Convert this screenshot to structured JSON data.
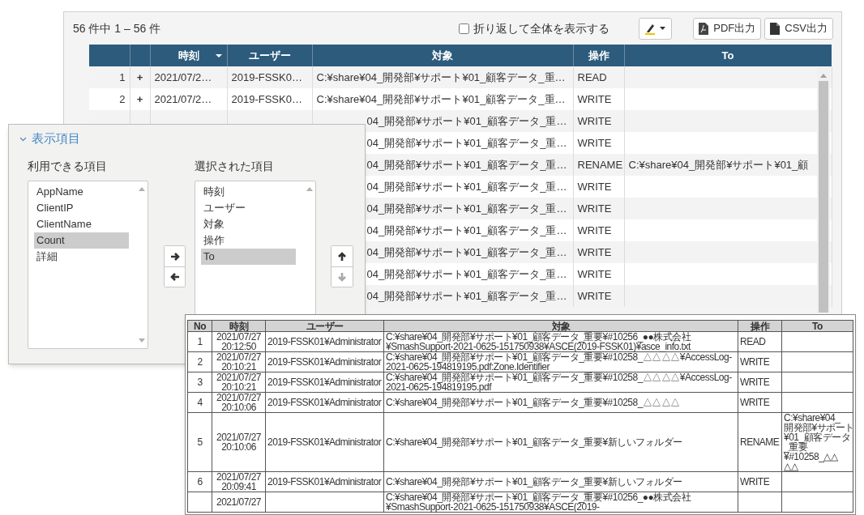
{
  "toolbar": {
    "count": "56 件中 1 – 56 件",
    "wrap": {
      "label": "折り返して全体を表示する",
      "checked": false
    },
    "buttons": [
      {
        "kind": "highlight"
      },
      {
        "kind": "pdf",
        "label": "PDF出力"
      },
      {
        "kind": "csv",
        "label": "CSV出力"
      }
    ]
  },
  "table": {
    "columns": [
      {
        "label": "時刻",
        "sorted": true
      },
      {
        "label": "ユーザー",
        "sorted": false
      },
      {
        "label": "対象",
        "sorted": false
      },
      {
        "label": "操作",
        "sorted": false
      },
      {
        "label": "To",
        "sorted": false
      }
    ],
    "rows": [
      {
        "no": "1",
        "expand": "+",
        "time": "2021/07/2…",
        "user": "2019-FSSK0…",
        "target": "C:¥share¥04_開発部¥サポート¥01_顧客データ_重…",
        "op": "READ"
      },
      {
        "no": "2",
        "expand": "+",
        "time": "2021/07/2…",
        "user": "2019-FSSK0…",
        "target": "C:¥share¥04_開発部¥サポート¥01_顧客データ_重…",
        "op": "WRITE"
      },
      {
        "target": "04_開発部¥サポート¥01_顧客データ_重…",
        "op": "WRITE"
      },
      {
        "target": "04_開発部¥サポート¥01_顧客データ_重…",
        "op": "WRITE"
      },
      {
        "target": "04_開発部¥サポート¥01_顧客データ_重…",
        "op": "RENAME",
        "to": "C:¥share¥04_開発部¥サポート¥01_顧"
      },
      {
        "target": "04_開発部¥サポート¥01_顧客データ_重…",
        "op": "WRITE"
      },
      {
        "target": "04_開発部¥サポート¥01_顧客データ_重…",
        "op": "WRITE"
      },
      {
        "target": "04_開発部¥サポート¥01_顧客データ_重…",
        "op": "WRITE"
      },
      {
        "target": "04_開発部¥サポート¥01_顧客データ_重…",
        "op": "WRITE"
      },
      {
        "target": "04_開発部¥サポート¥01_顧客データ_重…",
        "op": "WRITE"
      },
      {
        "target": "04_開発部¥サポート¥01_顧客データ_重…",
        "op": "WRITE"
      }
    ]
  },
  "display_items": {
    "title": "表示項目",
    "expanded": true,
    "available_label": "利用できる項目",
    "available": [
      {
        "label": "AppName",
        "selected": false
      },
      {
        "label": "ClientIP",
        "selected": false
      },
      {
        "label": "ClientName",
        "selected": false
      },
      {
        "label": "Count",
        "selected": true
      },
      {
        "label": "詳細",
        "selected": false
      }
    ],
    "chosen_label": "選択された項目",
    "chosen": [
      {
        "label": "時刻",
        "selected": false
      },
      {
        "label": "ユーザー",
        "selected": false
      },
      {
        "label": "対象",
        "selected": false
      },
      {
        "label": "操作",
        "selected": false
      },
      {
        "label": "To",
        "selected": true
      }
    ],
    "move_buttons": [
      {
        "kind": "right",
        "disabled": false
      },
      {
        "kind": "left",
        "disabled": false
      }
    ],
    "order_buttons": [
      {
        "kind": "up",
        "disabled": false
      },
      {
        "kind": "down",
        "disabled": true
      }
    ]
  },
  "report": {
    "columns": [
      "No",
      "時刻",
      "ユーザー",
      "対象",
      "操作",
      "To"
    ],
    "rows": [
      {
        "no": "1",
        "time": "2021/07/27\n20:12:50",
        "user": "2019-FSSK01¥Administrator",
        "target": "C:¥share¥04_開発部¥サポート¥01_顧客データ_重要¥#10256_●●株式会社\n¥SmashSupport-2021-0625-151750938¥ASCE(2019-FSSK01)¥asce_info.txt",
        "op": "READ"
      },
      {
        "no": "2",
        "time": "2021/07/27\n20:10:21",
        "user": "2019-FSSK01¥Administrator",
        "target": "C:¥share¥04_開発部¥サポート¥01_顧客データ_重要¥#10258_△△△△¥AccessLog-\n2021-0625-194819195.pdf:Zone.Identifier",
        "op": "WRITE"
      },
      {
        "no": "3",
        "time": "2021/07/27\n20:10:21",
        "user": "2019-FSSK01¥Administrator",
        "target": "C:¥share¥04_開発部¥サポート¥01_顧客データ_重要¥#10258_△△△△¥AccessLog-\n2021-0625-194819195.pdf",
        "op": "WRITE"
      },
      {
        "no": "4",
        "time": "2021/07/27\n20:10:06",
        "user": "2019-FSSK01¥Administrator",
        "target": "C:¥share¥04_開発部¥サポート¥01_顧客データ_重要¥#10258_△△△△",
        "op": "WRITE"
      },
      {
        "no": "5",
        "time": "2021/07/27\n20:10:06",
        "user": "2019-FSSK01¥Administrator",
        "target": "C:¥share¥04_開発部¥サポート¥01_顧客データ_重要¥新しいフォルダー",
        "op": "RENAME",
        "to": "C:¥share¥04_\n開発部¥サポート\n¥01_顧客データ\n_重要\n¥#10258_△△\n△△"
      },
      {
        "no": "6",
        "time": "2021/07/27\n20:09:41",
        "user": "2019-FSSK01¥Administrator",
        "target": "C:¥share¥04_開発部¥サポート¥01_顧客データ_重要¥新しいフォルダー",
        "op": "WRITE"
      },
      {
        "time": "2021/07/27",
        "target": "C:¥share¥04_開発部¥サポート¥01_顧客データ_重要¥#10256_●●株式会社\n¥SmashSupport-2021-0625-151750938¥ASCE(2019-"
      }
    ]
  }
}
